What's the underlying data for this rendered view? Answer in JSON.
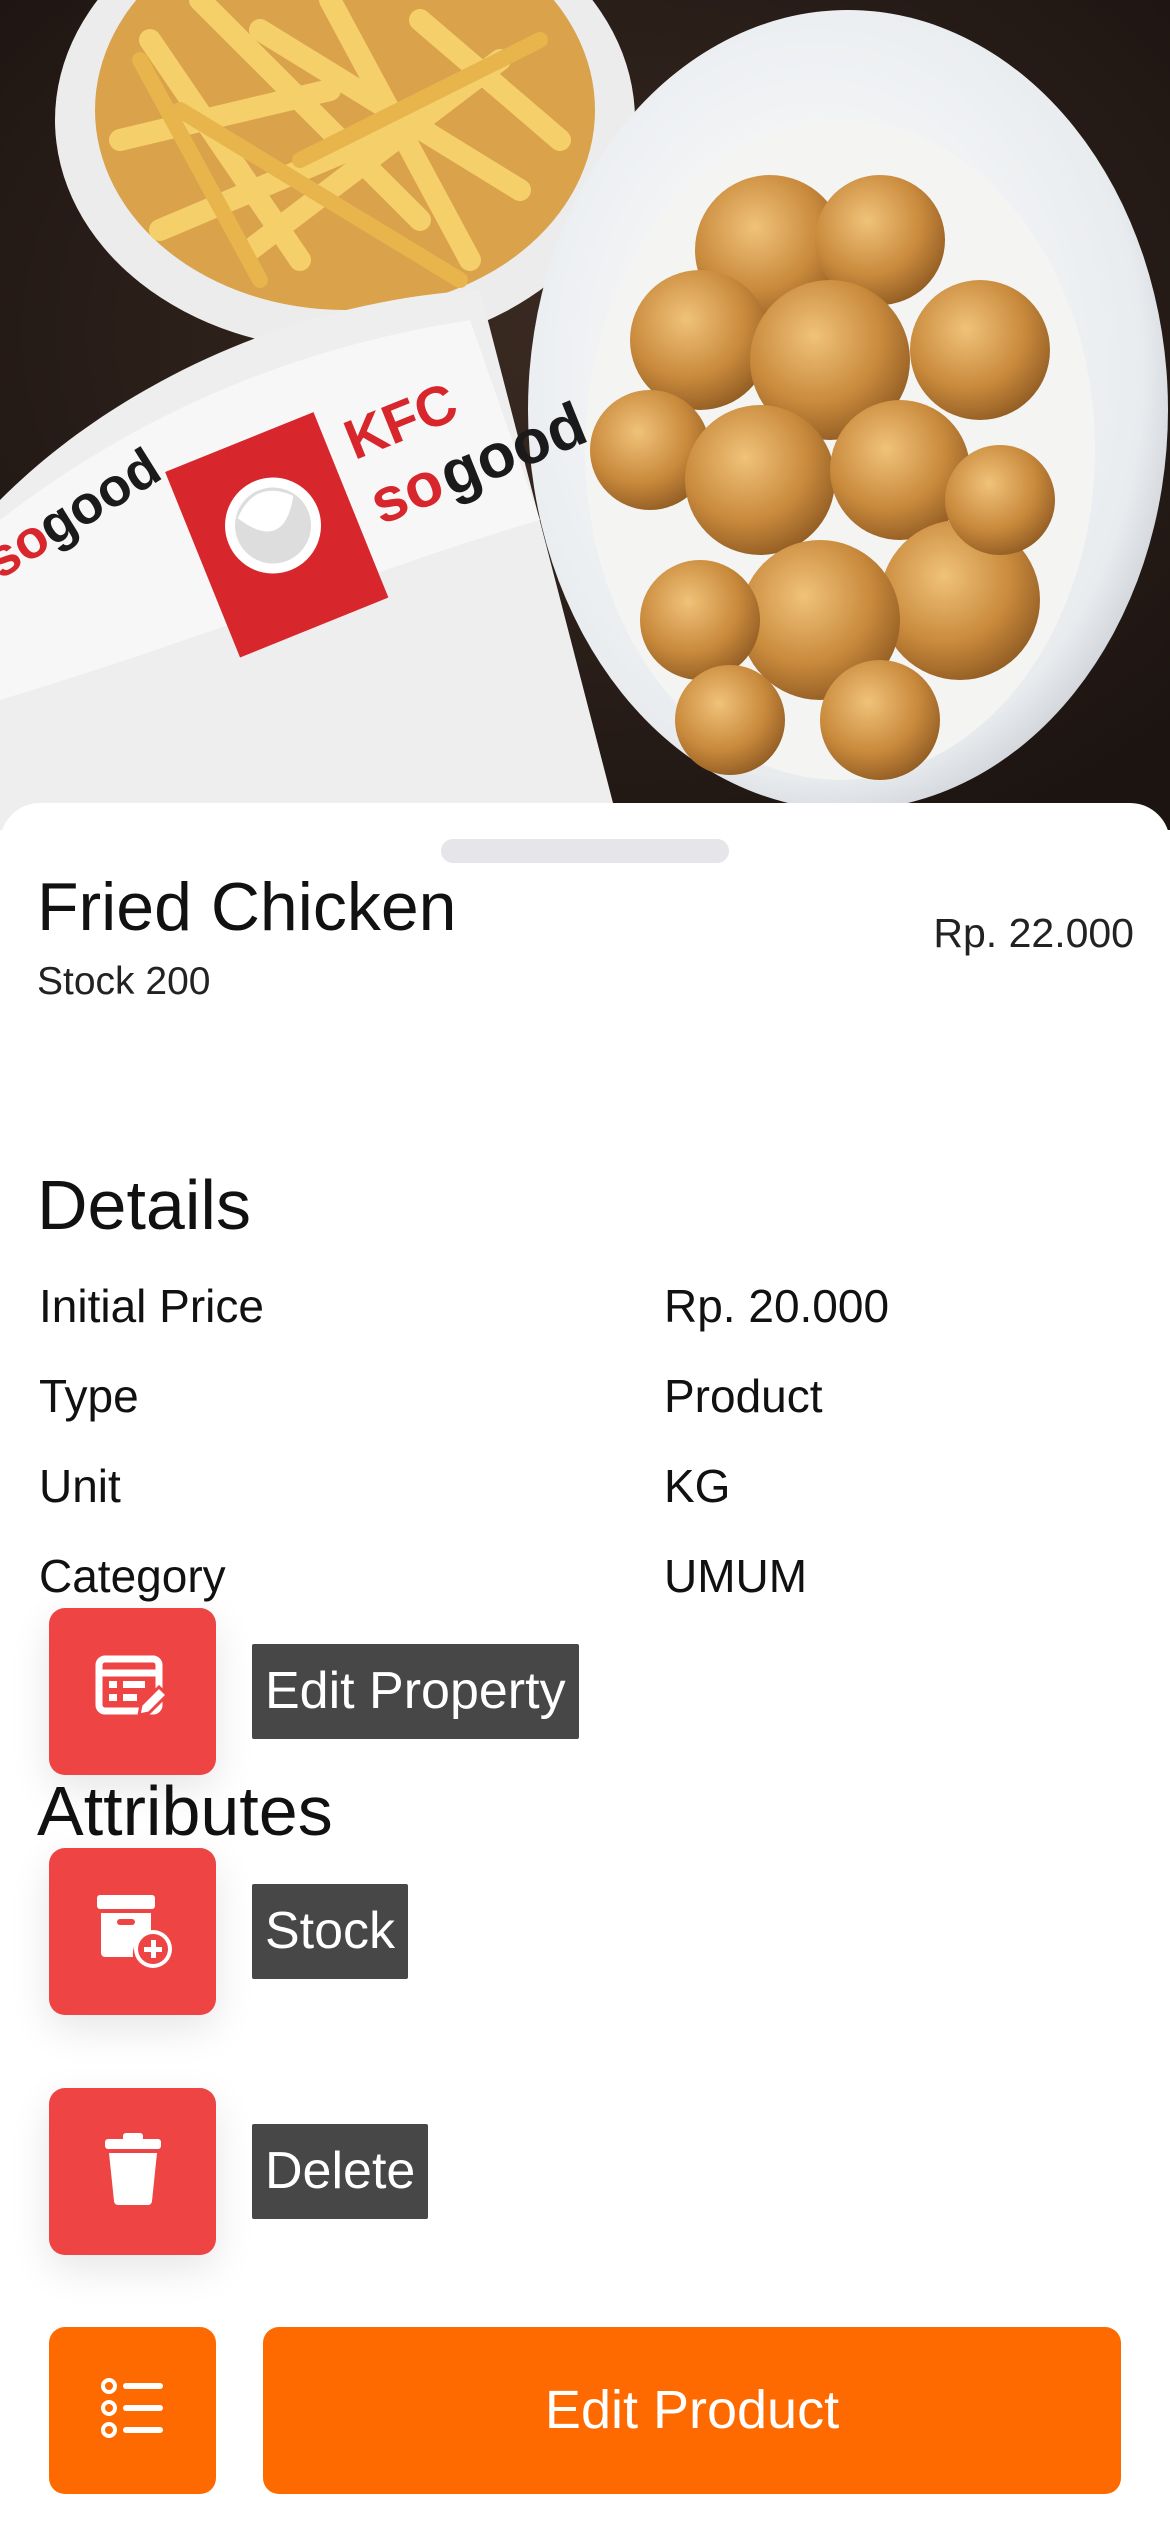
{
  "hero": {
    "image_subject": "KFC fried chicken and fries",
    "logo_text": "KFC so good"
  },
  "product": {
    "name": "Fried Chicken",
    "stock_text": "Stock 200",
    "price": "Rp. 22.000"
  },
  "details": {
    "heading": "Details",
    "rows": [
      {
        "label": "Initial Price",
        "value": "Rp. 20.000"
      },
      {
        "label": "Type",
        "value": "Product"
      },
      {
        "label": "Unit",
        "value": "KG"
      },
      {
        "label": "Category",
        "value": "UMUM"
      }
    ]
  },
  "attributes": {
    "heading": "Attributes"
  },
  "fab_menu": {
    "items": [
      {
        "label": "Edit Property",
        "icon": "edit-property-icon"
      },
      {
        "label": "Stock",
        "icon": "box-add-icon"
      },
      {
        "label": "Delete",
        "icon": "trash-icon"
      }
    ]
  },
  "actions": {
    "list_icon": "list-icon",
    "edit_product_label": "Edit Product"
  },
  "colors": {
    "danger": "#ef4444",
    "primary": "#ff6a00",
    "label_bg": "#474747"
  }
}
